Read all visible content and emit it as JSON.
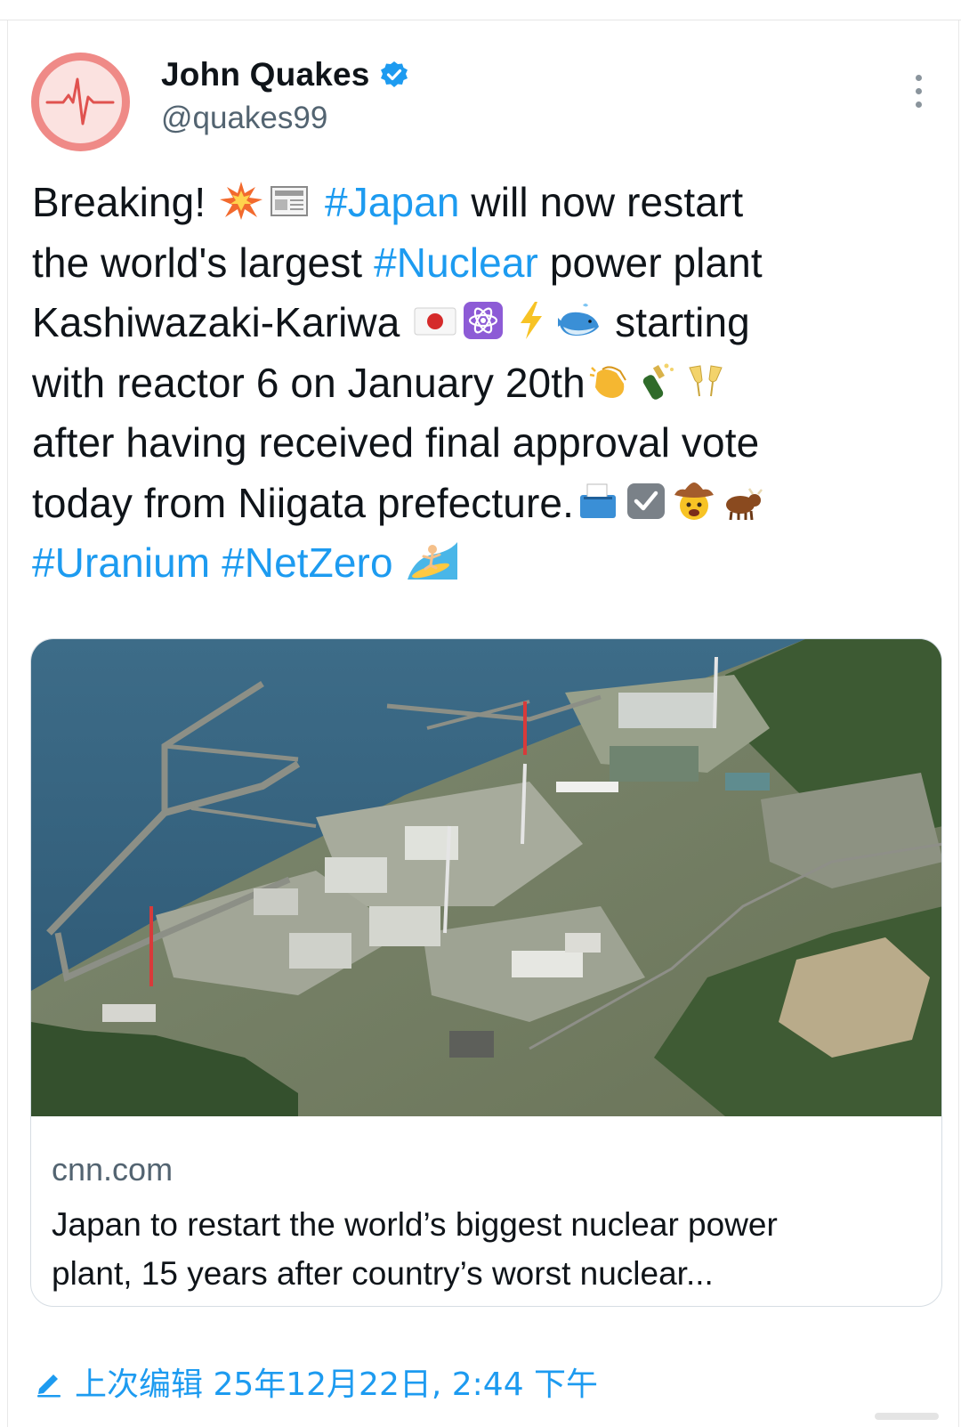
{
  "colors": {
    "hashtag": "#1d9bf0",
    "text": "#0f1419",
    "secondary": "#536471",
    "avatar_ring": "#ef8a87"
  },
  "author": {
    "display_name": "John Quakes",
    "handle": "@quakes99",
    "avatar_icon": "heartbeat-icon",
    "verified_icon": "verified-badge-icon"
  },
  "more_icon": "more-options-icon",
  "tweet": {
    "line1": {
      "a": "Breaking! ",
      "b": "#Japan",
      "c": " will now restart"
    },
    "line2": {
      "a": "the world's largest ",
      "b": "#Nuclear",
      "c": " power plant"
    },
    "line3": {
      "a": "Kashiwazaki-Kariwa ",
      "c": " starting"
    },
    "line4": {
      "a": "with reactor 6 on January 20th"
    },
    "line5": {
      "a": "after having received final approval vote"
    },
    "line6": {
      "a": "today from Niigata prefecture."
    },
    "line7": {
      "a": "#Uranium",
      "b": " ",
      "c": "#NetZero",
      "d": " "
    },
    "emojis": [
      "collision-emoji",
      "newspaper-emoji",
      "japan-flag-emoji",
      "atom-emoji",
      "lightning-emoji",
      "whale-emoji",
      "clapping-emoji",
      "champagne-emoji",
      "toast-emoji",
      "ballot-box-emoji",
      "check-box-emoji",
      "cowboy-emoji",
      "ox-emoji",
      "surfer-emoji"
    ]
  },
  "link_card": {
    "domain": "cnn.com",
    "title_line1": "Japan to restart the world’s biggest nuclear power",
    "title_line2": "plant, 15 years after country’s worst nuclear..."
  },
  "edited": {
    "icon": "edit-pencil-icon",
    "text": "上次编辑 25年12月22日, 2:44 下午"
  }
}
